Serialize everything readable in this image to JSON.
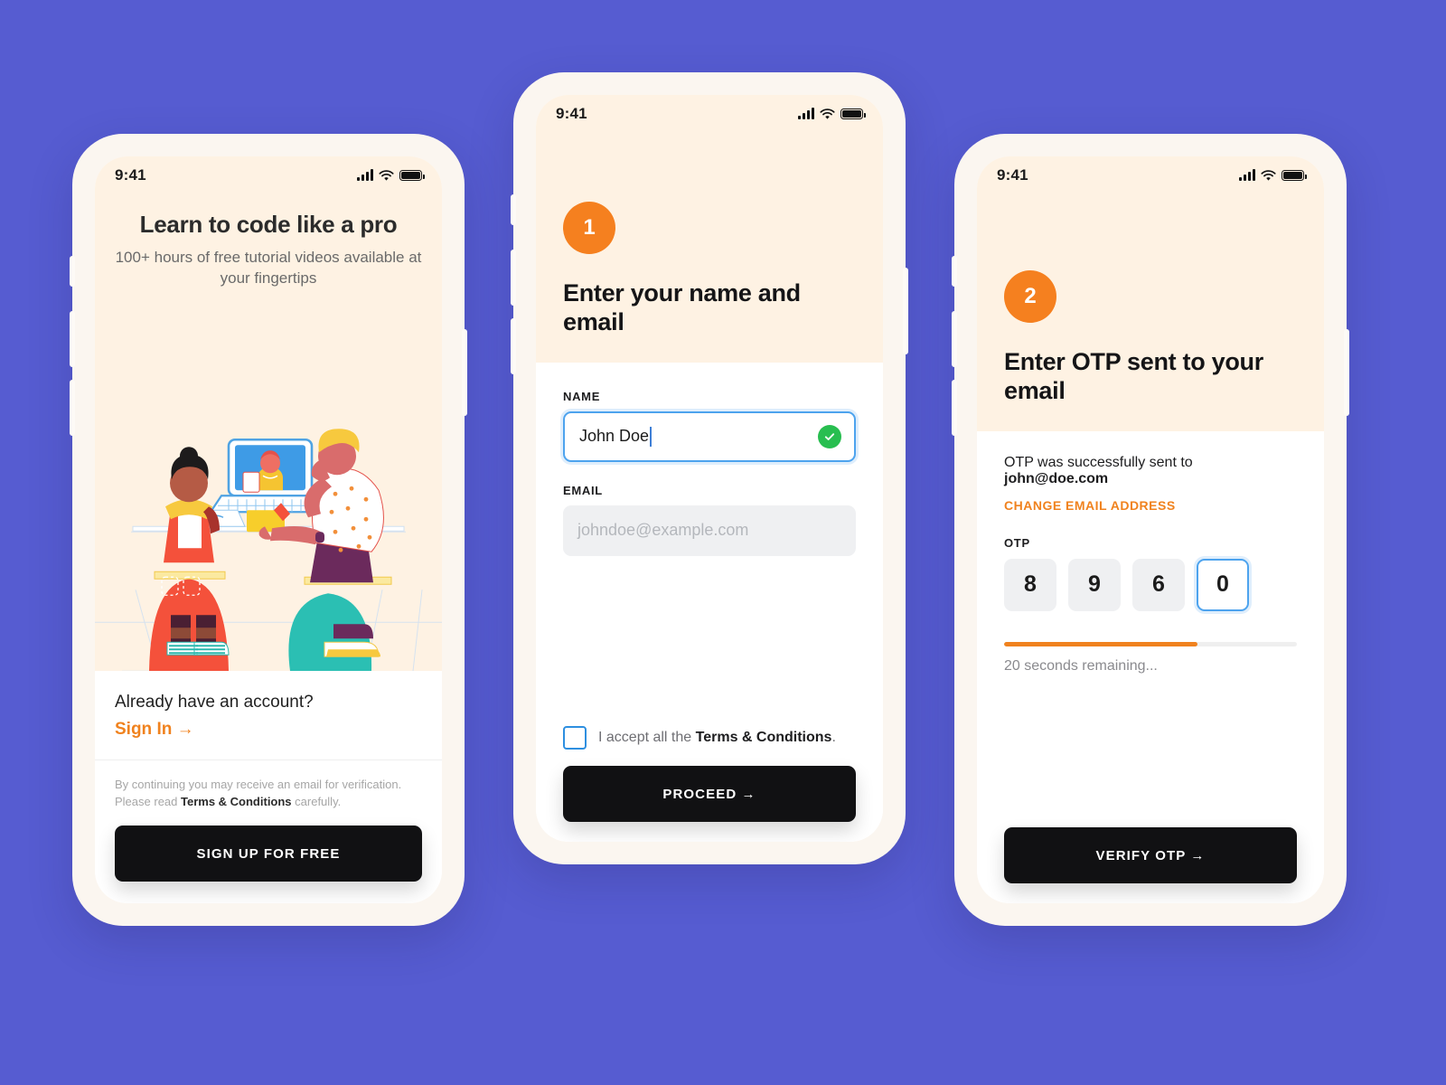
{
  "canvas": {
    "background_color": "#565CD1"
  },
  "theme": {
    "accent_orange": "#F5801F",
    "cream": "#FEF2E3",
    "dark_button": "#111113",
    "focus_blue": "#4DA3EE",
    "success_green": "#28BE50"
  },
  "status_bar": {
    "time": "9:41",
    "signal_icon": "cellular-signal-icon",
    "wifi_icon": "wifi-icon",
    "battery_icon": "battery-icon"
  },
  "screen1": {
    "title": "Learn to code like a pro",
    "subtitle": "100+ hours of free tutorial videos available at your fingertips",
    "illustration_name": "two-students-learning-illustration",
    "signin_question": "Already have an account?",
    "signin_link": "Sign In →",
    "legal_prefix": "By continuing you may receive an email for verification. Please read ",
    "legal_bold": "Terms & Conditions",
    "legal_suffix": " carefully.",
    "cta_label": "SIGN UP FOR FREE"
  },
  "screen2": {
    "step_badge": "1",
    "heading": "Enter your name and email",
    "name_label": "NAME",
    "name_value": "John Doe",
    "name_valid_icon": "check-circle-icon",
    "email_label": "EMAIL",
    "email_value": "",
    "email_placeholder": "johndoe@example.com",
    "terms_prefix": "I accept all the ",
    "terms_bold": "Terms & Conditions",
    "terms_suffix": ".",
    "terms_checked": false,
    "cta_label": "PROCEED →"
  },
  "screen3": {
    "step_badge": "2",
    "heading": "Enter OTP sent to your email",
    "sent_prefix": "OTP was successfully sent to ",
    "sent_email": "john@doe.com",
    "change_email_label": "CHANGE EMAIL ADDRESS",
    "otp_label": "OTP",
    "otp_digits": [
      "8",
      "9",
      "6",
      "0"
    ],
    "otp_focused_index": 3,
    "progress_percent": 66,
    "remaining_text": "20 seconds remaining...",
    "cta_label": "VERIFY OTP →"
  }
}
